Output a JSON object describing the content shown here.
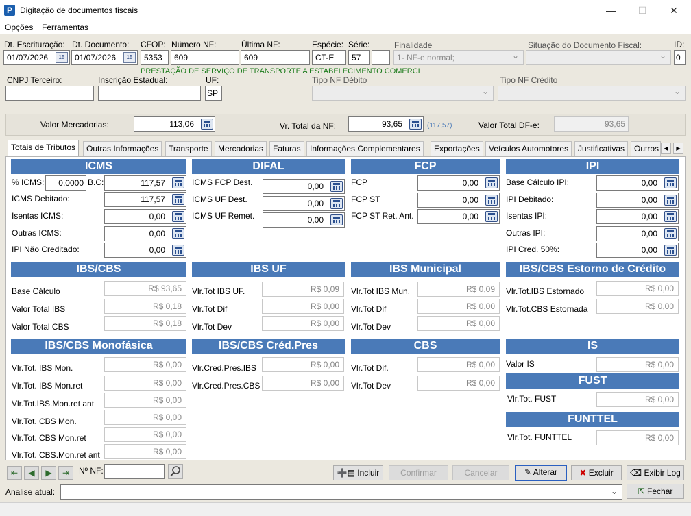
{
  "window": {
    "title": "Digitação de documentos fiscais",
    "icon": "app-p-icon",
    "minimize": "—",
    "maximize": "☐",
    "close": "✕"
  },
  "menu": [
    "Opções",
    "Ferramentas"
  ],
  "header": {
    "dt_escrituracao": {
      "label": "Dt. Escrituração:",
      "value": "01/07/2026"
    },
    "dt_documento": {
      "label": "Dt. Documento:",
      "value": "01/07/2026"
    },
    "cfop": {
      "label": "CFOP:",
      "value": "5353"
    },
    "numero_nf": {
      "label": "Número NF:",
      "value": "609"
    },
    "ultima_nf": {
      "label": "Última NF:",
      "value": "609"
    },
    "especie": {
      "label": "Espécie:",
      "value": "CT-E"
    },
    "serie": {
      "label": "Série:",
      "value": "57",
      "value2": ""
    },
    "finalidade": {
      "label": "Finalidade",
      "value": "1- NF-e normal;"
    },
    "situacao": {
      "label": "Situação do Documento Fiscal:",
      "value": ""
    },
    "id": {
      "label": "ID:",
      "value": "0"
    },
    "cfop_desc": "PRESTAÇÃO DE SERVIÇO DE TRANSPORTE A ESTABELECIMENTO COMERCI",
    "cnpj": {
      "label": "CNPJ Terceiro:",
      "value": ""
    },
    "ie": {
      "label": "Inscrição Estadual:",
      "value": ""
    },
    "uf": {
      "label": "UF:",
      "value": "SP"
    },
    "tipo_debito": {
      "label": "Tipo NF Débito",
      "value": ""
    },
    "tipo_credito": {
      "label": "Tipo NF Crédito",
      "value": ""
    }
  },
  "totals": {
    "valor_mercadorias": {
      "label": "Valor Mercadorias:",
      "value": "113,06"
    },
    "vr_total_nf": {
      "label": "Vr. Total da NF:",
      "value": "93,65",
      "hint": "(117,57)"
    },
    "valor_total_dfe": {
      "label": "Valor Total DF-e:",
      "value": "93,65"
    }
  },
  "tabs": [
    "Totais de Tributos",
    "Outras Informações",
    "Transporte",
    "Mercadorias",
    "Faturas",
    "Informações Complementares",
    "Exportações",
    "Veículos Automotores",
    "Justificativas",
    "Outros"
  ],
  "icms": {
    "title": "ICMS",
    "pct_label": "% ICMS:",
    "pct_value": "0,0000",
    "bc_label": "B.C:",
    "bc_value": "117,57",
    "rows": [
      {
        "label": "ICMS Debitado:",
        "value": "117,57"
      },
      {
        "label": "Isentas ICMS:",
        "value": "0,00"
      },
      {
        "label": "Outras ICMS:",
        "value": "0,00"
      },
      {
        "label": "IPI Não Creditado:",
        "value": "0,00"
      }
    ]
  },
  "difal": {
    "title": "DIFAL",
    "rows": [
      {
        "label": "ICMS FCP Dest.",
        "value": "0,00"
      },
      {
        "label": "ICMS UF Dest.",
        "value": "0,00"
      },
      {
        "label": "ICMS UF Remet.",
        "value": "0,00"
      }
    ]
  },
  "fcp": {
    "title": "FCP",
    "rows": [
      {
        "label": "FCP",
        "value": "0,00"
      },
      {
        "label": "FCP ST",
        "value": "0,00"
      },
      {
        "label": "FCP ST Ret. Ant.",
        "value": "0,00"
      }
    ]
  },
  "ipi": {
    "title": "IPI",
    "rows": [
      {
        "label": "Base Cálculo IPI:",
        "value": "0,00"
      },
      {
        "label": "IPI Debitado:",
        "value": "0,00"
      },
      {
        "label": "Isentas IPI:",
        "value": "0,00"
      },
      {
        "label": "Outras IPI:",
        "value": "0,00"
      },
      {
        "label": "IPI Cred. 50%:",
        "value": "0,00"
      }
    ]
  },
  "ibscbs": {
    "title": "IBS/CBS",
    "rows": [
      {
        "label": "Base Cálculo",
        "value": "R$ 93,65"
      },
      {
        "label": "Valor Total IBS",
        "value": "R$ 0,18"
      },
      {
        "label": "Valor Total CBS",
        "value": "R$ 0,18"
      }
    ]
  },
  "ibsuf": {
    "title": "IBS UF",
    "rows": [
      {
        "label": "Vlr.Tot IBS UF.",
        "value": "R$ 0,09"
      },
      {
        "label": "Vlr.Tot Dif",
        "value": "R$ 0,00"
      },
      {
        "label": "Vlr.Tot Dev",
        "value": "R$ 0,00"
      }
    ]
  },
  "ibsmun": {
    "title": "IBS Municipal",
    "rows": [
      {
        "label": "Vlr.Tot IBS Mun.",
        "value": "R$ 0,09"
      },
      {
        "label": "Vlr.Tot Dif",
        "value": "R$ 0,00"
      },
      {
        "label": "Vlr.Tot Dev",
        "value": "R$ 0,00"
      }
    ]
  },
  "estorno": {
    "title": "IBS/CBS Estorno de Crédito",
    "rows": [
      {
        "label": "Vlr.Tot.IBS Estornado",
        "value": "R$ 0,00"
      },
      {
        "label": "Vlr.Tot.CBS Estornada",
        "value": "R$ 0,00"
      }
    ]
  },
  "mono": {
    "title": "IBS/CBS Monofásica",
    "rows": [
      {
        "label": "Vlr.Tot. IBS Mon.",
        "value": "R$ 0,00"
      },
      {
        "label": "Vlr.Tot. IBS Mon.ret",
        "value": "R$ 0,00"
      },
      {
        "label": "Vlr.Tot.IBS.Mon.ret ant",
        "value": "R$ 0,00"
      },
      {
        "label": "Vlr.Tot. CBS Mon.",
        "value": "R$ 0,00"
      },
      {
        "label": "Vlr.Tot. CBS Mon.ret",
        "value": "R$ 0,00"
      },
      {
        "label": "Vlr.Tot. CBS.Mon.ret ant",
        "value": "R$ 0,00"
      }
    ]
  },
  "credpres": {
    "title": "IBS/CBS Créd.Pres",
    "rows": [
      {
        "label": "Vlr.Cred.Pres.IBS",
        "value": "R$ 0,00"
      },
      {
        "label": "Vlr.Cred.Pres.CBS",
        "value": "R$ 0,00"
      }
    ]
  },
  "cbs": {
    "title": "CBS",
    "rows": [
      {
        "label": "Vlr.Tot Dif.",
        "value": "R$ 0,00"
      },
      {
        "label": "Vlr.Tot Dev",
        "value": "R$ 0,00"
      }
    ]
  },
  "is": {
    "title": "IS",
    "rows": [
      {
        "label": "Valor IS",
        "value": "R$ 0,00"
      }
    ]
  },
  "fust": {
    "title": "FUST",
    "rows": [
      {
        "label": "Vlr.Tot. FUST",
        "value": "R$ 0,00"
      }
    ]
  },
  "funttel": {
    "title": "FUNTTEL",
    "rows": [
      {
        "label": "Vlr.Tot. FUNTTEL",
        "value": "R$ 0,00"
      }
    ]
  },
  "bottom": {
    "nf_label": "Nº NF:",
    "nf_value": "",
    "incluir": "Incluir",
    "confirmar": "Confirmar",
    "cancelar": "Cancelar",
    "alterar": "Alterar",
    "excluir": "Excluir",
    "exibir_log": "Exibir Log",
    "analise_label": "Analise atual:",
    "analise_value": "",
    "fechar": "Fechar"
  }
}
